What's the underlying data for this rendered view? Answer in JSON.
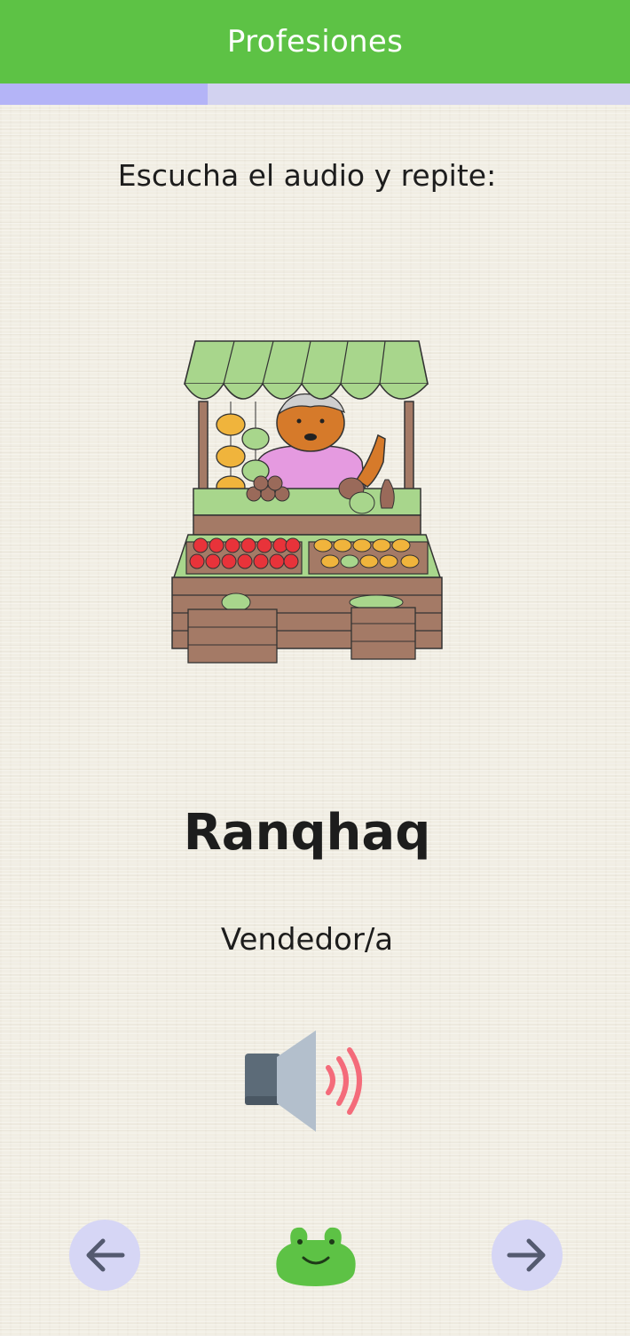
{
  "header": {
    "title": "Profesiones"
  },
  "progress": {
    "fraction": 0.33
  },
  "lesson": {
    "instruction": "Escucha el audio y repite:",
    "word": "Ranqhaq",
    "translation": "Vendedor/a",
    "illustration": "market-vendor-stall-illustration"
  },
  "audio": {
    "icon": "speaker-icon"
  },
  "navigation": {
    "prev_icon": "arrow-left-icon",
    "next_icon": "arrow-right-icon",
    "mascot": "frog-icon"
  },
  "colors": {
    "header": "#5dc245",
    "progress_fill": "#b4b4f7",
    "progress_track": "#d2d2f0",
    "nav_button": "#d6d6f5",
    "speaker_waves": "#f46b7a",
    "frog": "#5dc245"
  }
}
